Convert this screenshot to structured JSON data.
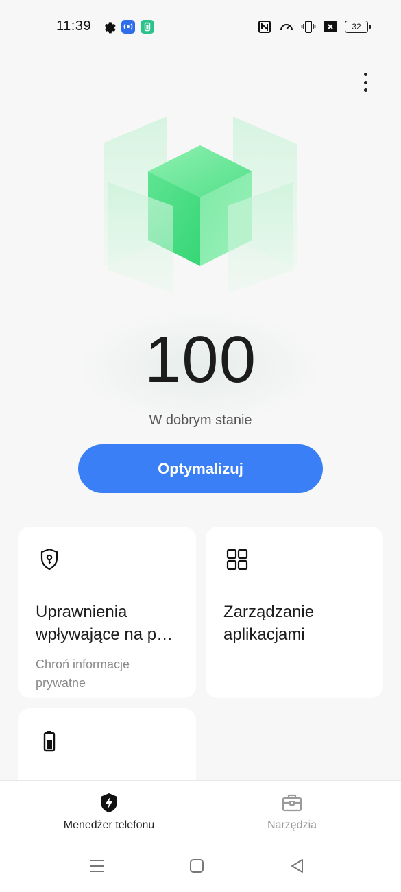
{
  "status_bar": {
    "time": "11:39",
    "battery": "32",
    "icons": [
      "gear-icon",
      "hotspot-app-icon",
      "battery-saver-app-icon",
      "nfc-icon",
      "speed-icon",
      "vibrate-icon",
      "no-signal-icon",
      "battery-icon"
    ]
  },
  "header": {
    "more_icon": "more-vert-icon"
  },
  "health": {
    "score": "100",
    "status": "W dobrym stanie",
    "accent": "#3dd87a"
  },
  "optimize_button": {
    "label": "Optymalizuj",
    "color": "#3a7ff6"
  },
  "cards": [
    {
      "icon": "shield-key-icon",
      "title_line1": "Uprawnienia",
      "title_line2": "wpływające na p…",
      "subtitle_line1": "Chroń informacje",
      "subtitle_line2": "prywatne"
    },
    {
      "icon": "apps-grid-icon",
      "title_line1": "Zarządzanie",
      "title_line2": "aplikacjami"
    },
    {
      "icon": "battery-icon"
    }
  ],
  "bottom_nav": {
    "items": [
      {
        "label": "Menedżer telefonu",
        "icon": "shield-bolt-icon",
        "active": true
      },
      {
        "label": "Narzędzia",
        "icon": "toolbox-icon",
        "active": false
      }
    ]
  },
  "system_nav": [
    "menu-icon",
    "home-icon",
    "back-icon"
  ]
}
